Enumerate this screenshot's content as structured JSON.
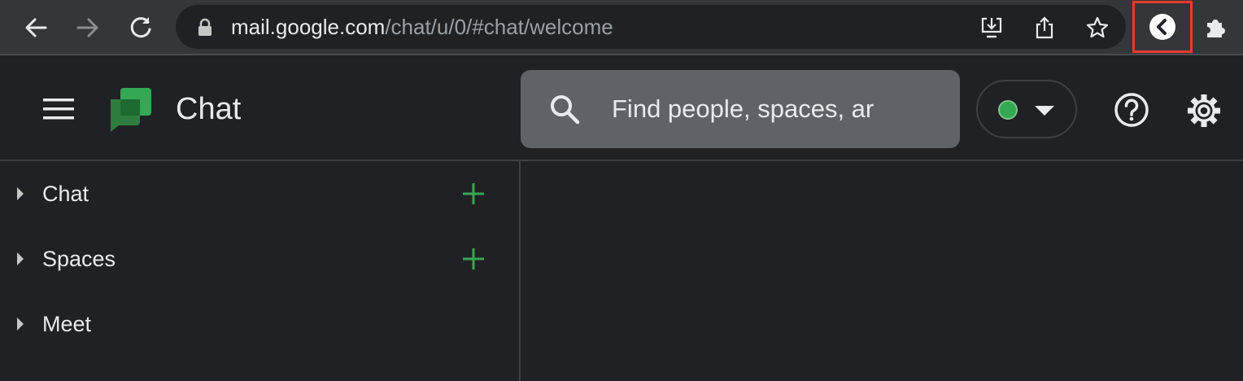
{
  "browser": {
    "url_host": "mail.google.com",
    "url_path": "/chat/u/0/#chat/welcome",
    "icons": [
      "back-arrow-icon",
      "forward-arrow-icon",
      "reload-icon",
      "lock-icon",
      "install-app-icon",
      "share-icon",
      "bookmark-star-icon",
      "extension-chevron-left-icon",
      "puzzle-extensions-icon"
    ],
    "highlight_color": "#e53b2c"
  },
  "header": {
    "app_title": "Chat",
    "search_placeholder": "Find people, spaces, ar",
    "status_color": "#34a853",
    "icons": [
      "hamburger-menu-icon",
      "chat-logo",
      "search-icon",
      "chevron-down-icon",
      "help-circle-icon",
      "settings-gear-icon"
    ]
  },
  "sidebar": {
    "sections": [
      {
        "label": "Chat",
        "has_add": true
      },
      {
        "label": "Spaces",
        "has_add": true
      },
      {
        "label": "Meet",
        "has_add": false
      }
    ],
    "add_color": "#34a853"
  }
}
